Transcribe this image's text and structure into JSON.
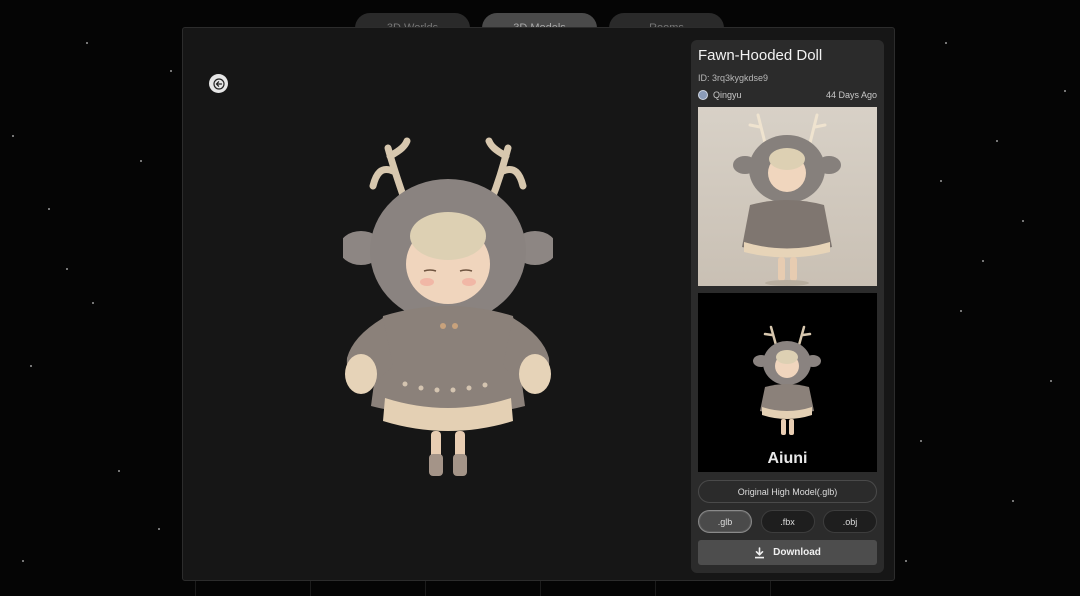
{
  "top_tabs": [
    "3D Worlds",
    "3D Models",
    "Rooms"
  ],
  "model": {
    "title": "Fawn-Hooded Doll",
    "id_text": "ID: 3rq3kygkdse9",
    "author": "Qingyu",
    "age": "44 Days Ago"
  },
  "watermark": "Aiuni",
  "original_button": "Original High Model(.glb)",
  "formats": [
    ".glb",
    ".fbx",
    ".obj"
  ],
  "selected_format": ".glb",
  "download_label": "Download",
  "icons": {
    "back": "arrow-left-icon",
    "download": "download-icon",
    "avatar": "avatar-icon"
  },
  "colors": {
    "modal_bg": "#161616",
    "panel_bg": "#2b2b2b",
    "download_bg": "#4d4d4d"
  }
}
